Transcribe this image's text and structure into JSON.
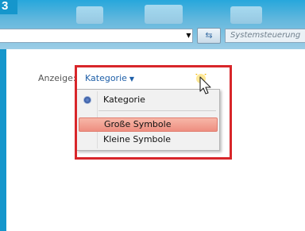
{
  "step": {
    "number": "3"
  },
  "toolbar": {
    "address_value": "",
    "refresh_icon": "refresh-icon",
    "dropdown_icon": "chevron-down-icon",
    "search_placeholder": "Systemsteuerung"
  },
  "view": {
    "label": "Anzeige:",
    "current": "Kategorie"
  },
  "menu": {
    "items": [
      {
        "label": "Kategorie",
        "selected": true
      },
      {
        "label": "Große Symbole",
        "hovered": true
      },
      {
        "label": "Kleine Symbole"
      }
    ]
  },
  "colors": {
    "accent_border": "#1596cc",
    "highlight_frame": "#d8262a",
    "hover_item": "#f2a595",
    "link": "#1e5fa8"
  }
}
